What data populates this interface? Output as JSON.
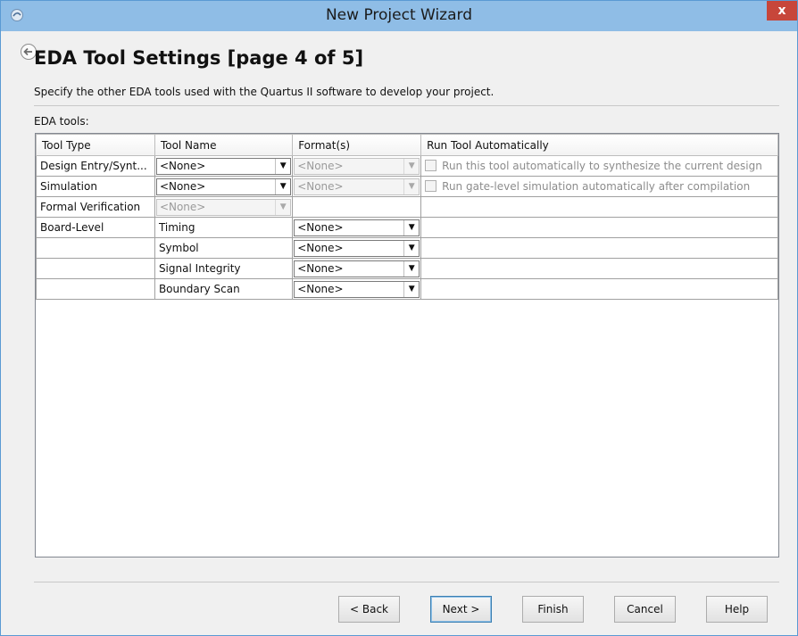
{
  "window": {
    "title": "New Project Wizard",
    "close_label": "x"
  },
  "page": {
    "title": "EDA Tool Settings [page 4 of 5]",
    "description": "Specify the other EDA tools used with the Quartus II software to develop your project.",
    "eda_tools_label": "EDA tools:"
  },
  "table": {
    "headers": {
      "tool_type": "Tool Type",
      "tool_name": "Tool Name",
      "formats": "Format(s)",
      "run_auto": "Run Tool Automatically"
    },
    "rows": [
      {
        "tool_type": "Design Entry/Synt...",
        "tool_name": "<None>",
        "format": "<None>",
        "run_text": "Run this tool automatically to synthesize the current design"
      },
      {
        "tool_type": "Simulation",
        "tool_name": "<None>",
        "format": "<None>",
        "run_text": "Run gate-level simulation automatically after compilation"
      },
      {
        "tool_type": "Formal Verification",
        "tool_name": "<None>"
      },
      {
        "tool_type": "Board-Level",
        "tool_name": "Timing",
        "format": "<None>"
      },
      {
        "tool_type": "",
        "tool_name": "Symbol",
        "format": "<None>"
      },
      {
        "tool_type": "",
        "tool_name": "Signal Integrity",
        "format": "<None>"
      },
      {
        "tool_type": "",
        "tool_name": "Boundary Scan",
        "format": "<None>"
      }
    ]
  },
  "buttons": {
    "back": "< Back",
    "next": "Next >",
    "finish": "Finish",
    "cancel": "Cancel",
    "help": "Help"
  },
  "icons": {
    "app": "quartus-app-icon",
    "back": "back-arrow-icon",
    "dropdown": "chevron-down-icon"
  },
  "colors": {
    "titlebar": "#8fbde6",
    "close": "#c7463a",
    "window_bg": "#f0f0f0"
  }
}
